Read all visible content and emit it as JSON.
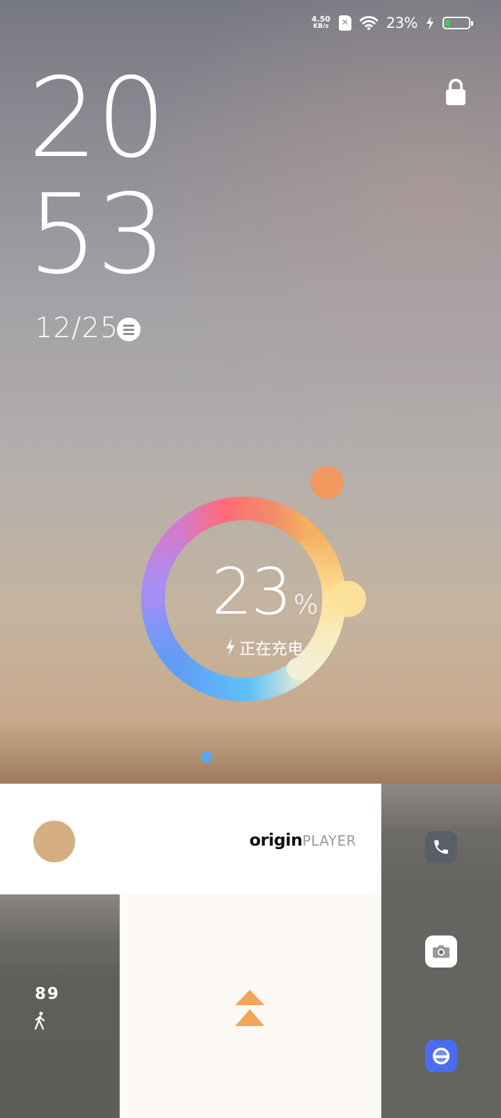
{
  "status_bar": {
    "net_speed_value": "4.50",
    "net_speed_unit": "KB/s",
    "battery_percent": "23%",
    "battery_level": 0.23,
    "icons": [
      "no-sim-icon",
      "wifi-icon",
      "charging-bolt-icon",
      "battery-icon"
    ]
  },
  "clock": {
    "hour": "20",
    "minute": "53",
    "date": "12/25"
  },
  "battery_ring": {
    "value": "23",
    "unit": "%",
    "status": "正在充电",
    "colors": [
      "#ff6b76",
      "#f5b060",
      "#fde39a",
      "#5ec2f7",
      "#5f9df5",
      "#a78ff5"
    ],
    "orb_color": "#f2985f"
  },
  "widgets": {
    "music_brand_main": "origin",
    "music_brand_sub": "PLAYER",
    "steps": "89"
  },
  "shortcuts": [
    "phone-icon",
    "camera-icon",
    "gallery-icon"
  ],
  "colors": {
    "accent_orange": "#f3a457",
    "page_dot": "#57a8f1",
    "music_avatar": "#d6ae83"
  }
}
